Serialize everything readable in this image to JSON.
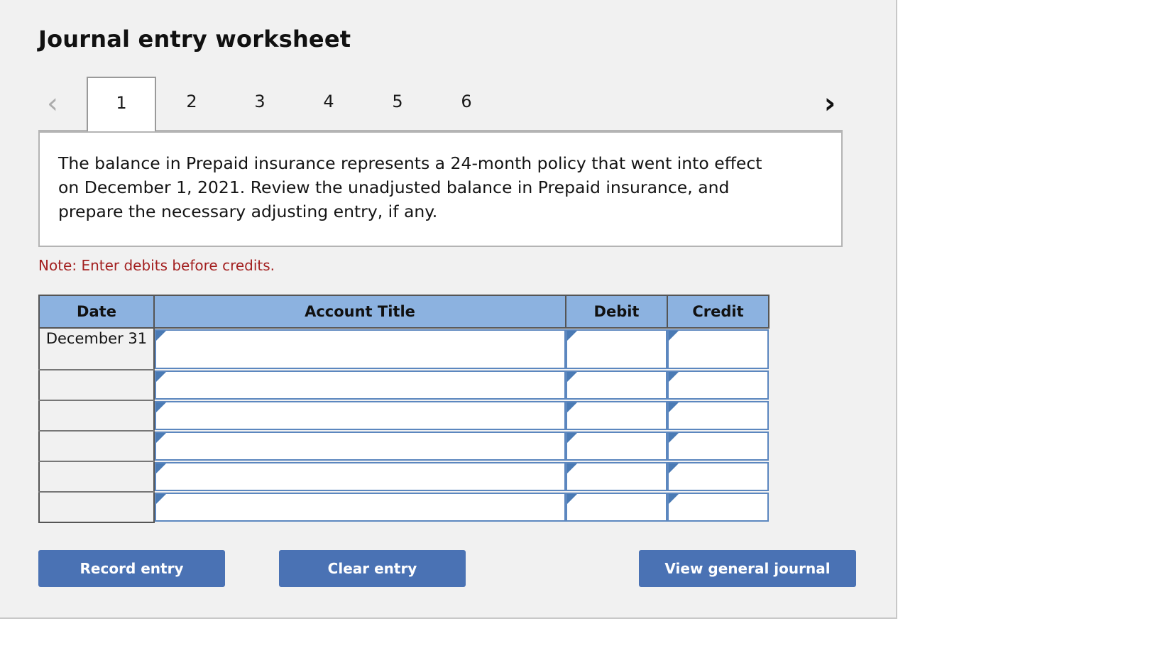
{
  "worksheet": {
    "title": "Journal entry worksheet",
    "nav": {
      "prev_icon": "chevron-left-icon",
      "prev_glyph": "‹",
      "next_icon": "chevron-right-icon",
      "next_glyph": "›",
      "prev_enabled_color": "#acacac",
      "next_enabled_color": "#111111"
    },
    "tabs": [
      {
        "label": "1",
        "active": true
      },
      {
        "label": "2",
        "active": false
      },
      {
        "label": "3",
        "active": false
      },
      {
        "label": "4",
        "active": false
      },
      {
        "label": "5",
        "active": false
      },
      {
        "label": "6",
        "active": false
      }
    ],
    "instruction": "The balance in Prepaid insurance represents a 24-month policy that went into effect on December 1, 2021. Review the unadjusted balance in Prepaid insurance, and prepare the necessary adjusting entry, if any.",
    "note": "Note: Enter debits before credits.",
    "note_color": "#a32020"
  },
  "table": {
    "headers": [
      "Date",
      "Account Title",
      "Debit",
      "Credit"
    ],
    "header_bg": "#8cb2e0",
    "rows": [
      {
        "date": "December 31",
        "account_title": "",
        "debit": "",
        "credit": ""
      },
      {
        "date": "",
        "account_title": "",
        "debit": "",
        "credit": ""
      },
      {
        "date": "",
        "account_title": "",
        "debit": "",
        "credit": ""
      },
      {
        "date": "",
        "account_title": "",
        "debit": "",
        "credit": ""
      },
      {
        "date": "",
        "account_title": "",
        "debit": "",
        "credit": ""
      },
      {
        "date": "",
        "account_title": "",
        "debit": "",
        "credit": ""
      }
    ]
  },
  "actions": {
    "record": "Record entry",
    "clear": "Clear entry",
    "journal": "View general journal",
    "button_color": "#4a72b4"
  }
}
